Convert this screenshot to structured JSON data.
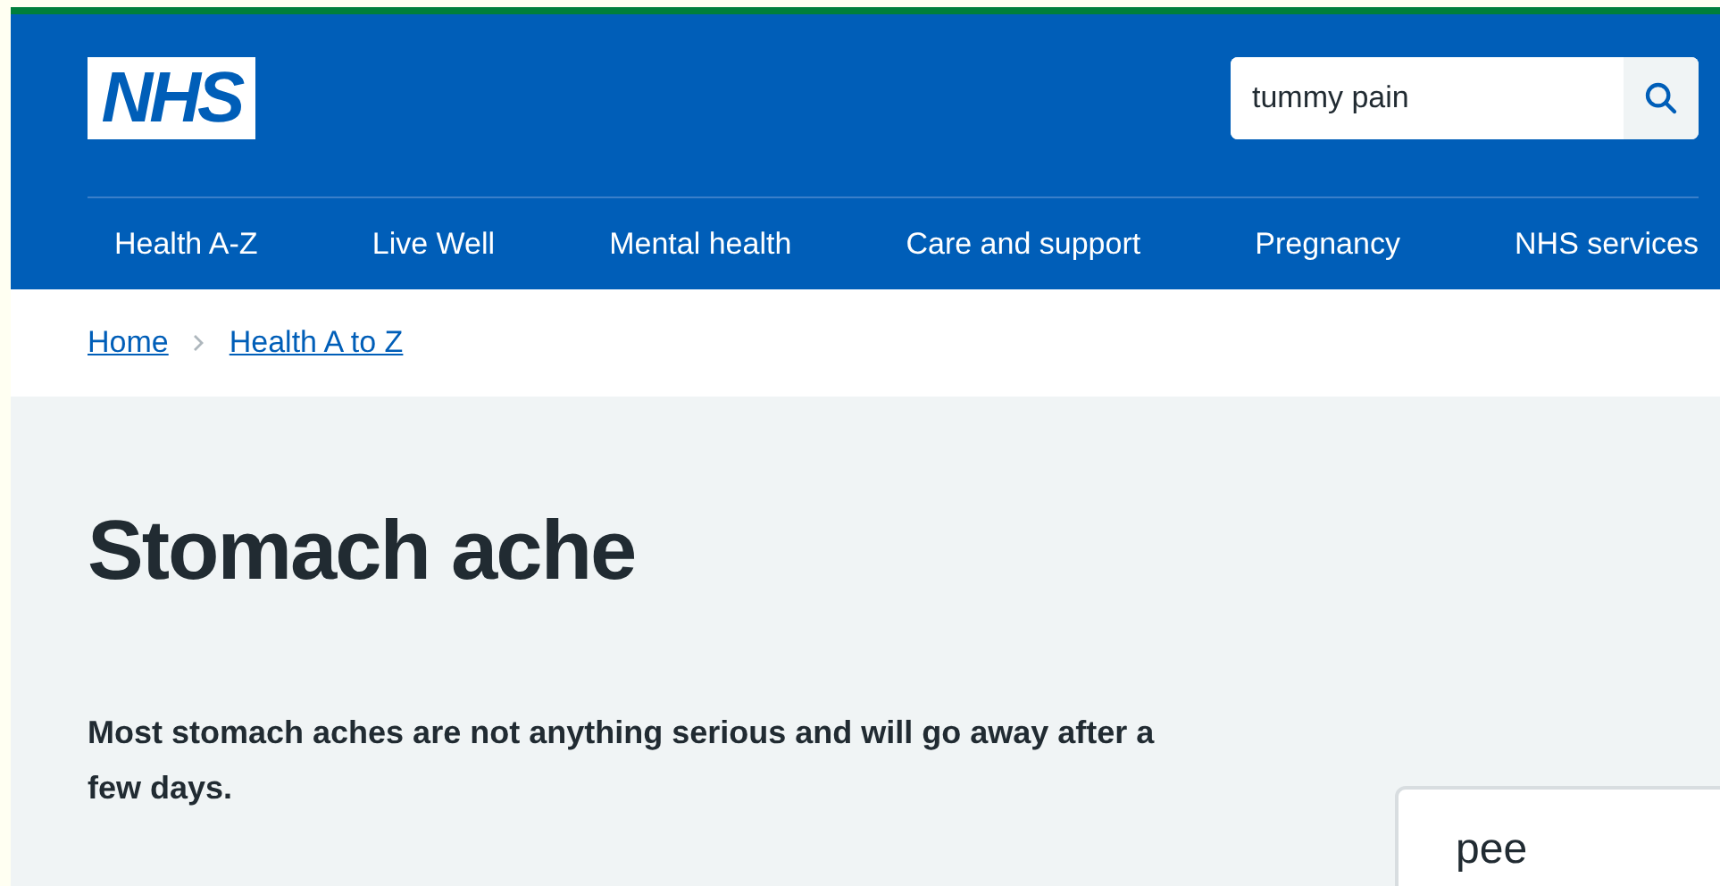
{
  "header": {
    "logo": "NHS",
    "search": {
      "value": "tummy pain"
    },
    "nav": [
      {
        "label": "Health A-Z"
      },
      {
        "label": "Live Well"
      },
      {
        "label": "Mental health"
      },
      {
        "label": "Care and support"
      },
      {
        "label": "Pregnancy"
      },
      {
        "label": "NHS services"
      }
    ]
  },
  "breadcrumbs": [
    {
      "label": "Home"
    },
    {
      "label": "Health A to Z"
    }
  ],
  "title": "Stomach ache",
  "intro": "Most stomach aches are not anything serious and will go away after a few days.",
  "side_card": {
    "text": "pee"
  }
}
